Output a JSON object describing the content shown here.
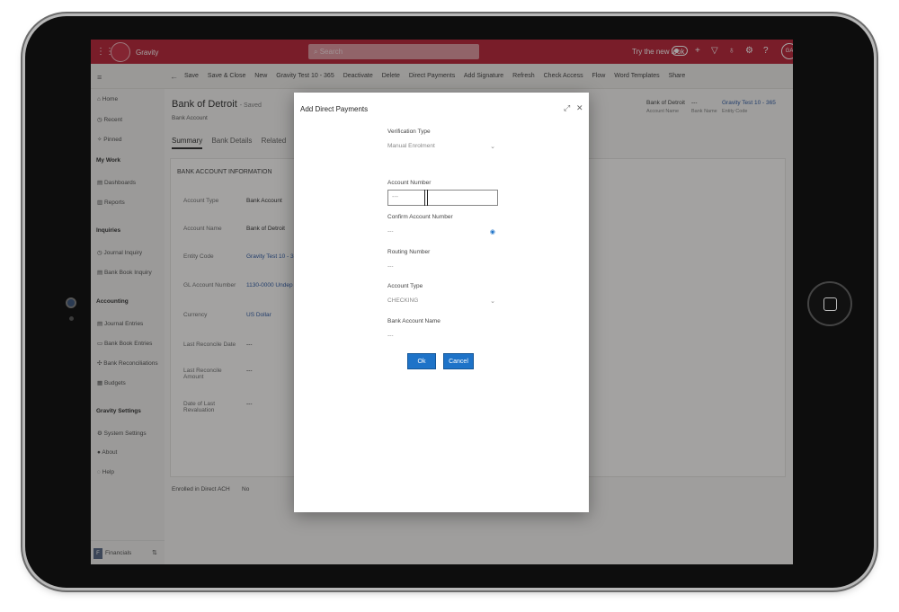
{
  "topbar": {
    "app_name": "Gravity",
    "search_placeholder": "Search",
    "try_new_look": "Try the new look",
    "avatar_initials": "GA"
  },
  "commandbar": {
    "items": [
      "Save",
      "Save & Close",
      "New",
      "Gravity Test 10 - 365",
      "Deactivate",
      "Delete",
      "Direct Payments",
      "Add Signature",
      "Refresh",
      "Check Access",
      "Flow",
      "Word Templates",
      "Share"
    ]
  },
  "sidebar": {
    "home": "Home",
    "recent": "Recent",
    "pinned": "Pinned",
    "my_work": "My Work",
    "dashboards": "Dashboards",
    "reports": "Reports",
    "inquiries": "Inquiries",
    "journal_inquiry": "Journal Inquiry",
    "bank_book_inquiry": "Bank Book Inquiry",
    "accounting": "Accounting",
    "journal_entries": "Journal Entries",
    "bank_book_entries": "Bank Book Entries",
    "bank_reconciliations": "Bank Reconciliations",
    "budgets": "Budgets",
    "gravity_settings": "Gravity Settings",
    "system_settings": "System Settings",
    "about": "About",
    "help": "Help",
    "area_badge": "F",
    "area": "Financials"
  },
  "record": {
    "title": "Bank of Detroit",
    "saved": "- Saved",
    "subtitle": "Bank Account",
    "tabs": [
      "Summary",
      "Bank Details",
      "Related"
    ],
    "header_fields": [
      {
        "value": "Bank of Detroit",
        "label": "Account Name"
      },
      {
        "value": "---",
        "label": "Bank Name"
      },
      {
        "value": "Gravity Test 10 - 365",
        "label": "Entity Code"
      }
    ]
  },
  "section": {
    "title": "BANK ACCOUNT INFORMATION",
    "fields": [
      {
        "label": "Account Type",
        "value": "Bank Account"
      },
      {
        "label": "Account Name",
        "value": "Bank of Detroit"
      },
      {
        "label": "Entity Code",
        "value": "Gravity Test 10 - 3"
      },
      {
        "label": "GL Account Number",
        "value": "1130-0000 Undep"
      },
      {
        "label": "Currency",
        "value": "US Dollar"
      },
      {
        "label": "Last Reconcile Date",
        "value": "---"
      },
      {
        "label": "Last Reconcile Amount",
        "value": "---"
      },
      {
        "label": "Date of Last Revaluation",
        "value": "---"
      }
    ],
    "enrolled_label": "Enrolled in Direct ACH",
    "enrolled_value": "No"
  },
  "dialog": {
    "title": "Add Direct Payments",
    "verification_type_label": "Verification Type",
    "verification_type_value": "Manual Enrolment",
    "account_number_label": "Account Number",
    "account_number_placeholder": "---",
    "confirm_account_number_label": "Confirm Account Number",
    "confirm_account_number_value": "---",
    "routing_number_label": "Routing Number",
    "routing_number_value": "---",
    "account_type_label": "Account Type",
    "account_type_value": "CHECKING",
    "bank_account_name_label": "Bank Account Name",
    "bank_account_name_value": "---",
    "ok_label": "Ok",
    "cancel_label": "Cancel"
  }
}
